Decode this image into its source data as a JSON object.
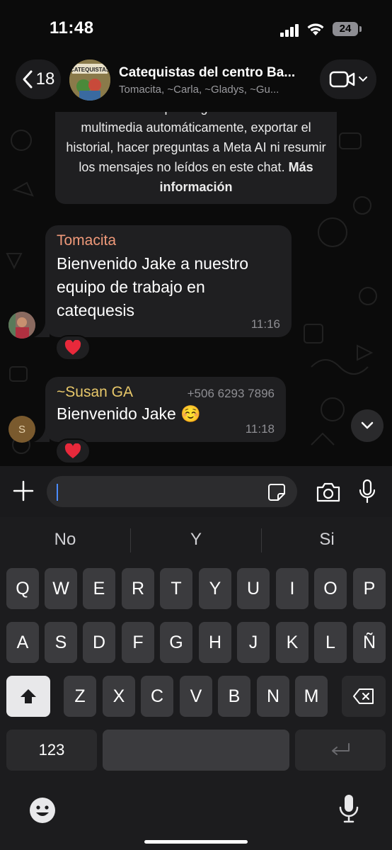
{
  "status_bar": {
    "time": "11:48",
    "battery": "24"
  },
  "header": {
    "back_count": "18",
    "title": "Catequistas del centro Ba...",
    "members": "Tomacita, ~Carla, ~Gladys, ~Gu...",
    "avatar_text": "CATEQUISTAS"
  },
  "chat": {
    "system_message": {
      "text": "chat. Nadie podrá guardar archivos multimedia automáticamente, exportar el historial, hacer preguntas a Meta AI ni resumir los mensajes no leídos en este chat.",
      "link": "Más información"
    },
    "messages": [
      {
        "sender": "Tomacita",
        "text": "Bienvenido Jake a nuestro equipo de trabajo en catequesis",
        "time": "11:16",
        "reaction": "❤️"
      },
      {
        "sender": "~Susan GA",
        "phone": "+506 6293 7896",
        "text": "Bienvenido Jake ☺️",
        "time": "11:18",
        "reaction": "❤️",
        "avatar_initial": "S"
      }
    ]
  },
  "input": {
    "placeholder": ""
  },
  "keyboard": {
    "suggestions": [
      "No",
      "Y",
      "Si"
    ],
    "row1": [
      "Q",
      "W",
      "E",
      "R",
      "T",
      "Y",
      "U",
      "I",
      "O",
      "P"
    ],
    "row2": [
      "A",
      "S",
      "D",
      "F",
      "G",
      "H",
      "J",
      "K",
      "L",
      "Ñ"
    ],
    "row3": [
      "Z",
      "X",
      "C",
      "V",
      "B",
      "N",
      "M"
    ],
    "numbers_key": "123"
  },
  "colors": {
    "background": "#0b0b0b",
    "bubble": "#1f1f21",
    "sender_tomacita": "#f09a7a",
    "sender_susan": "#e8c86a",
    "caret": "#4a8cff"
  }
}
